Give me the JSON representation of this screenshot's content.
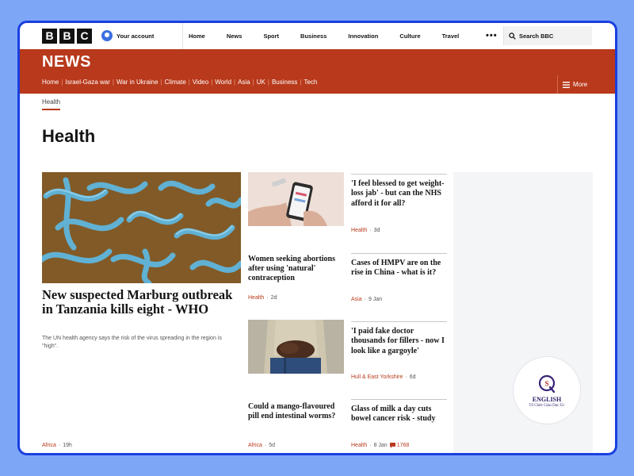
{
  "header": {
    "logo_letters": [
      "B",
      "B",
      "C"
    ],
    "account_label": "Your account",
    "nav": [
      "Home",
      "News",
      "Sport",
      "Business",
      "Innovation",
      "Culture",
      "Travel"
    ],
    "more_dots": "•••",
    "search_placeholder": "Search BBC"
  },
  "news_band": {
    "title": "NEWS",
    "nav": [
      "Home",
      "Israel-Gaza war",
      "War in Ukraine",
      "Climate",
      "Video",
      "World",
      "Asia",
      "UK",
      "Business",
      "Tech"
    ],
    "more_label": "More",
    "color": "#b8391b"
  },
  "subnav": {
    "active": "Health"
  },
  "page": {
    "title": "Health"
  },
  "hero": {
    "image": "marburg-virus-micrograph",
    "title": "New suspected Marburg outbreak in Tanzania kills eight - WHO",
    "description": "The UN health agency says the risk of the virus spreading in the region is \"high\".",
    "tag": "Africa",
    "time": "19h"
  },
  "mid_cards": [
    {
      "image": "hand-holding-phone-with-pills",
      "title": "Women seeking abortions after using 'natural' contraception",
      "tag": "Health",
      "time": "2d"
    },
    {
      "image": "child-holding-stomach",
      "title": "Could a mango-flavoured pill end intestinal worms?",
      "tag": "Africa",
      "time": "5d"
    }
  ],
  "right_cards": [
    {
      "title": "'I feel blessed to get weight-loss jab' - but can the NHS afford it for all?",
      "tag": "Health",
      "time": "3d"
    },
    {
      "title": "Cases of HMPV are on the rise in China - what is it?",
      "tag": "Asia",
      "time": "9 Jan"
    },
    {
      "title": "'I paid fake doctor thousands for fillers - now I look like a gargoyle'",
      "tag": "Hull & East Yorkshire",
      "time": "6d"
    },
    {
      "title": "Glass of milk a day cuts bowel cancer risk - study",
      "tag": "Health",
      "time": "8 Jan",
      "comments": "1768"
    }
  ],
  "watermark": {
    "logo_letters": "QS",
    "name": "ENGLISH",
    "subtitle": "Tổ Chức Giáo Dục Úc"
  },
  "colors": {
    "accent": "#b8391b",
    "frame_border": "#1a3fe0",
    "background": "#7da7f6"
  }
}
